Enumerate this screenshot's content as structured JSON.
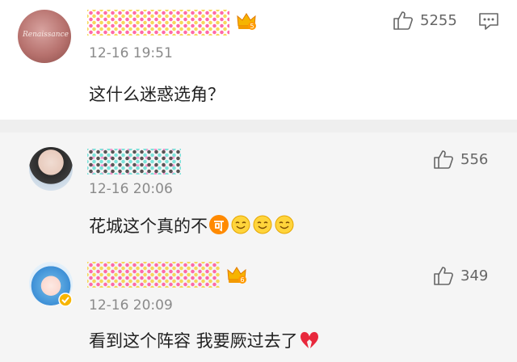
{
  "comments": [
    {
      "timestamp": "12-16 19:51",
      "text": "这什么迷惑选角？",
      "likes": "5255",
      "avatar_label": "Renaissance",
      "badge_level": "5"
    },
    {
      "timestamp": "12-16 20:06",
      "text": "花城这个真的不",
      "likes": "556"
    },
    {
      "timestamp": "12-16 20:09",
      "text": "看到这个阵容 我要厥过去了",
      "likes": "349",
      "badge_level": "6"
    }
  ],
  "icons": {
    "like": "thumbs-up-icon",
    "reply": "comment-bubble-icon",
    "member_badge": "crown-badge-icon",
    "verified": "verified-badge-icon",
    "emojis": [
      "ke-emoji",
      "smile-emoji",
      "smile-emoji",
      "smile-emoji",
      "broken-heart-emoji"
    ]
  },
  "colors": {
    "background": "#ffffff",
    "reply_background": "#f5f5f5",
    "divider": "#efefef",
    "timestamp": "#8a8a8a",
    "emoji_orange": "#ff8a00"
  }
}
